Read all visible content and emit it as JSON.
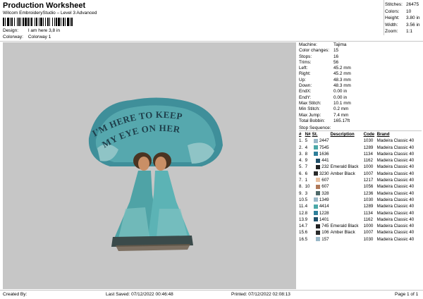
{
  "header": {
    "title": "Production Worksheet",
    "subtitle": "Wilcom EmbroideryStudio – Level 3 Advanced",
    "design_label": "Design:",
    "design_value": "I am here 3,8 in",
    "colorway_label": "Colorway:",
    "colorway_value": "Colorway 1"
  },
  "stats": [
    {
      "label": "Stitches:",
      "value": "26475"
    },
    {
      "label": "Colors:",
      "value": "10"
    },
    {
      "label": "Height:",
      "value": "3.80 in"
    },
    {
      "label": "Width:",
      "value": "3.56 in"
    },
    {
      "label": "Zoom:",
      "value": "1:1"
    }
  ],
  "design_text": {
    "line1": "I'M HERE TO KEEP",
    "line2": "MY EYE ON HER"
  },
  "machine": [
    {
      "label": "Machine:",
      "value": "Tajima"
    },
    {
      "label": "Color changes:",
      "value": "15"
    },
    {
      "label": "Stops:",
      "value": "16"
    },
    {
      "label": "Trims:",
      "value": "56"
    },
    {
      "label": "Left:",
      "value": "45.2 mm"
    },
    {
      "label": "Right:",
      "value": "45.2 mm"
    },
    {
      "label": "Up:",
      "value": "48.3 mm"
    },
    {
      "label": "Down:",
      "value": "48.3 mm"
    },
    {
      "label": "EndX:",
      "value": "0.00 in"
    },
    {
      "label": "EndY:",
      "value": "0.00 in"
    },
    {
      "label": "Max Stitch:",
      "value": "10.1 mm"
    },
    {
      "label": "Min Stitch:",
      "value": "0.2 mm"
    },
    {
      "label": "Max Jump:",
      "value": "7.4 mm"
    },
    {
      "label": "Total Bobbin:",
      "value": "165.17ft"
    }
  ],
  "sequence": {
    "title": "Stop Sequence:",
    "headers": [
      "#",
      "N#",
      "St.",
      "Description",
      "Code",
      "Brand"
    ],
    "rows": [
      {
        "num": "1.",
        "n": "5",
        "color": "#9ab8c8",
        "st": "2447",
        "desc": "",
        "code": "1030",
        "brand": "Madeira Classic 40"
      },
      {
        "num": "2.",
        "n": "4",
        "color": "#4aa8a8",
        "st": "7545",
        "desc": "",
        "code": "1289",
        "brand": "Madeira Classic 40"
      },
      {
        "num": "3.",
        "n": "8",
        "color": "#2e7f9a",
        "st": "1636",
        "desc": "",
        "code": "1134",
        "brand": "Madeira Classic 40"
      },
      {
        "num": "4.",
        "n": "9",
        "color": "#1f4f68",
        "st": "441",
        "desc": "",
        "code": "1162",
        "brand": "Madeira Classic 40"
      },
      {
        "num": "5.",
        "n": "7",
        "color": "#222222",
        "st": "232",
        "desc": "Emerald Black",
        "code": "1000",
        "brand": "Madeira Classic 40"
      },
      {
        "num": "6.",
        "n": "6",
        "color": "#2a2a2a",
        "st": "3230",
        "desc": "Amber Black",
        "code": "1007",
        "brand": "Madeira Classic 40"
      },
      {
        "num": "7.",
        "n": "1",
        "color": "#e8c0a0",
        "st": "607",
        "desc": "",
        "code": "1217",
        "brand": "Madeira Classic 40"
      },
      {
        "num": "8.",
        "n": "10",
        "color": "#b07858",
        "st": "607",
        "desc": "",
        "code": "1056",
        "brand": "Madeira Classic 40"
      },
      {
        "num": "9.",
        "n": "3",
        "color": "#4f6a6a",
        "st": "328",
        "desc": "",
        "code": "1236",
        "brand": "Madeira Classic 40"
      },
      {
        "num": "10.",
        "n": "5",
        "color": "#9ab8c8",
        "st": "1349",
        "desc": "",
        "code": "1030",
        "brand": "Madeira Classic 40"
      },
      {
        "num": "11.",
        "n": "4",
        "color": "#4aa8a8",
        "st": "4414",
        "desc": "",
        "code": "1289",
        "brand": "Madeira Classic 40"
      },
      {
        "num": "12.",
        "n": "8",
        "color": "#2e7f9a",
        "st": "1228",
        "desc": "",
        "code": "1134",
        "brand": "Madeira Classic 40"
      },
      {
        "num": "13.",
        "n": "9",
        "color": "#1f4f68",
        "st": "1401",
        "desc": "",
        "code": "1162",
        "brand": "Madeira Classic 40"
      },
      {
        "num": "14.",
        "n": "7",
        "color": "#222222",
        "st": "745",
        "desc": "Emerald Black",
        "code": "1000",
        "brand": "Madeira Classic 40"
      },
      {
        "num": "15.",
        "n": "6",
        "color": "#2a2a2a",
        "st": "106",
        "desc": "Amber Black",
        "code": "1007",
        "brand": "Madeira Classic 40"
      },
      {
        "num": "16.",
        "n": "5",
        "color": "#9ab8c8",
        "st": "157",
        "desc": "",
        "code": "1030",
        "brand": "Madeira Classic 40"
      }
    ]
  },
  "footer": {
    "created_by": "Created By:",
    "last_saved": "Last Saved: 07/12/2022 00:46:48",
    "printed": "Printed: 07/12/2022 02:08:13",
    "page": "Page 1 of 1"
  }
}
